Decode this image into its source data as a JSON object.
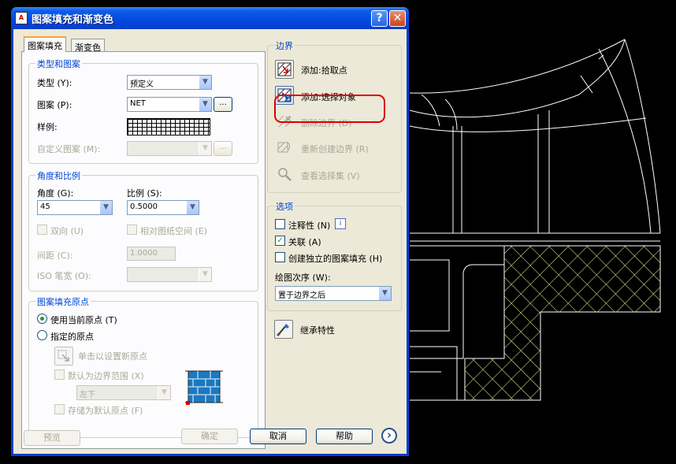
{
  "window": {
    "title": "图案填充和渐变色",
    "help_glyph": "?",
    "close_glyph": "✕",
    "app_icon_text": "A"
  },
  "tabs": [
    {
      "label": "图案填充",
      "selected": true
    },
    {
      "label": "渐变色",
      "selected": false
    }
  ],
  "type_pattern": {
    "group_title": "类型和图案",
    "type_label": "类型 (Y):",
    "type_value": "预定义",
    "pattern_label": "图案 (P):",
    "pattern_value": "NET",
    "sample_label": "样例:",
    "custom_label": "自定义图案 (M):",
    "custom_value": "",
    "browse_label": "..."
  },
  "angle_scale": {
    "group_title": "角度和比例",
    "angle_label": "角度 (G):",
    "angle_value": "45",
    "scale_label": "比例 (S):",
    "scale_value": "0.5000",
    "double_label": "双向 (U)",
    "paper_space_label": "相对图纸空间 (E)",
    "spacing_label": "间距 (C):",
    "spacing_value": "1.0000",
    "iso_label": "ISO 笔宽 (O):",
    "iso_value": ""
  },
  "origin": {
    "group_title": "图案填充原点",
    "use_current_label": "使用当前原点 (T)",
    "specified_label": "指定的原点",
    "click_set_label": "单击以设置新原点",
    "default_extents_label": "默认为边界范围 (X)",
    "position_value": "左下",
    "store_default_label": "存储为默认原点 (F)"
  },
  "boundaries": {
    "group_title": "边界",
    "add_pick_label": "添加:拾取点",
    "add_select_label": "添加:选择对象",
    "remove_label": "删除边界 (D)",
    "recreate_label": "重新创建边界 (R)",
    "view_selection_label": "查看选择集 (V)"
  },
  "options": {
    "group_title": "选项",
    "annotative_label": "注释性 (N)",
    "annotative_checked": false,
    "info_glyph": "i",
    "associative_label": "关联 (A)",
    "associative_checked": true,
    "separate_label": "创建独立的图案填充 (H)",
    "separate_checked": false,
    "draw_order_label": "绘图次序 (W):",
    "draw_order_value": "置于边界之后",
    "checkmark": "✓"
  },
  "inherit": {
    "label": "继承特性"
  },
  "footer": {
    "preview_label": "预览",
    "ok_label": "确定",
    "cancel_label": "取消",
    "help_label": "帮助",
    "expand_glyph": "›"
  },
  "colors": {
    "title_bar": "#0048e0",
    "dialog_bg": "#ece9d8",
    "group_title": "#0046d5",
    "highlight": "#dd0000",
    "cad_lines": "#ffffff",
    "cad_hatch": "#ffff99"
  }
}
